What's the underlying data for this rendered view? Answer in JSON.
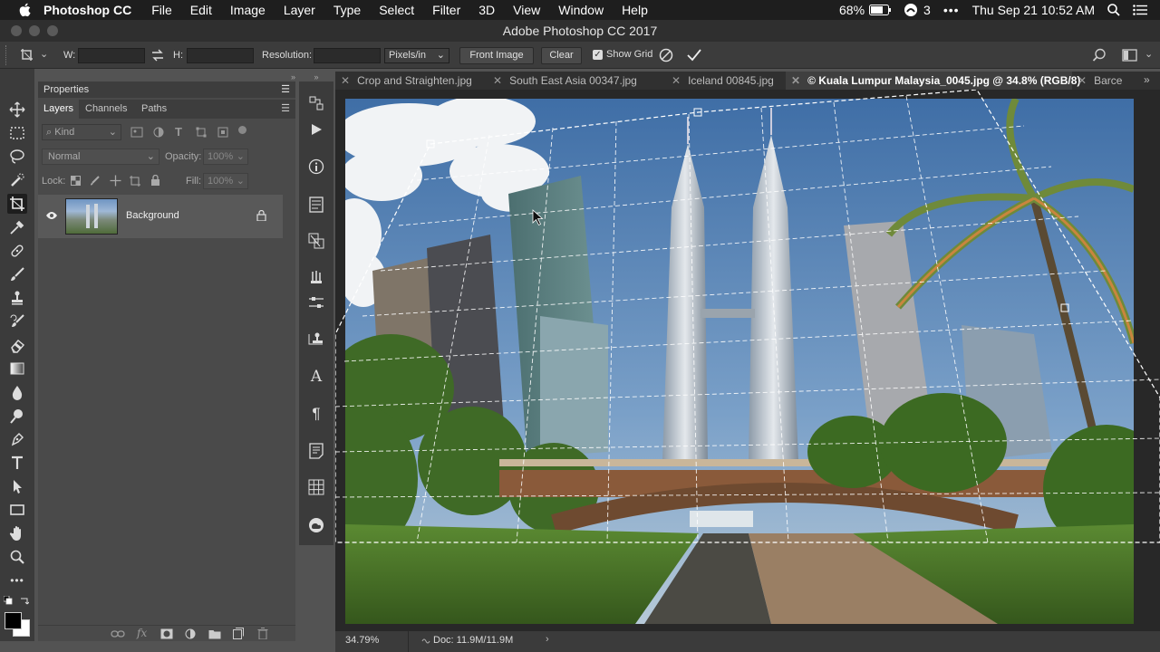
{
  "menubar": {
    "app_name": "Photoshop CC",
    "menus": [
      "File",
      "Edit",
      "Image",
      "Layer",
      "Type",
      "Select",
      "Filter",
      "3D",
      "View",
      "Window",
      "Help"
    ],
    "battery": "68%",
    "notifications": "3",
    "clock": "Thu Sep 21  10:52 AM"
  },
  "window": {
    "title": "Adobe Photoshop CC 2017"
  },
  "options": {
    "w_label": "W:",
    "h_label": "H:",
    "resolution_label": "Resolution:",
    "units_value": "Pixels/in",
    "front_image_label": "Front Image",
    "clear_label": "Clear",
    "show_grid_label": "Show Grid",
    "show_grid_checked": true
  },
  "panel": {
    "title": "Properties",
    "tabs": [
      "Layers",
      "Channels",
      "Paths"
    ],
    "filter_placeholder": "Kind",
    "blend_mode": "Normal",
    "opacity_label": "Opacity:",
    "opacity_value": "100%",
    "lock_label": "Lock:",
    "fill_label": "Fill:",
    "fill_value": "100%",
    "layers": [
      {
        "name": "Background",
        "locked": true,
        "visible": true
      }
    ]
  },
  "doc_tabs": [
    {
      "label": "Crop and Straighten.jpg",
      "active": false
    },
    {
      "label": "South East Asia 00347.jpg",
      "active": false
    },
    {
      "label": "Iceland 00845.jpg",
      "active": false
    },
    {
      "label": "© Kuala Lumpur Malaysia_0045.jpg @ 34.8% (RGB/8)",
      "active": true
    },
    {
      "label": "Barcel",
      "active": false
    }
  ],
  "status": {
    "zoom": "34.79%",
    "doc_size": "Doc: 11.9M/11.9M"
  },
  "colors": {
    "accent": "#3d7bd6",
    "panel_bg": "#4a4a4a",
    "dark_bg": "#282828"
  }
}
